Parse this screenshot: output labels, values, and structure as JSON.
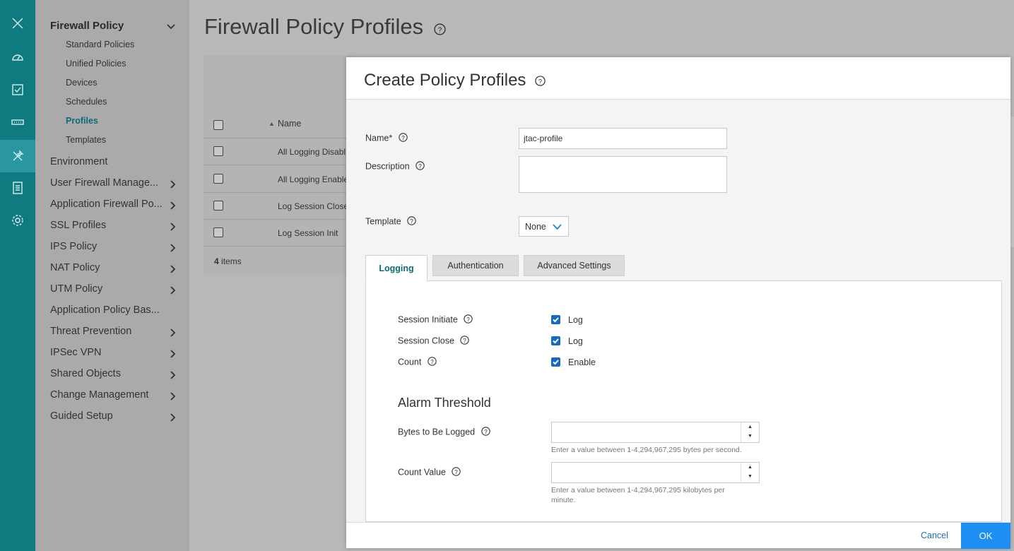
{
  "rail": {
    "icons": [
      "close-icon",
      "dashboard-icon",
      "monitor-icon",
      "devices-icon",
      "configure-icon",
      "reports-icon",
      "settings-icon"
    ]
  },
  "nav": {
    "group_title": "Firewall Policy",
    "subitems": [
      "Standard Policies",
      "Unified Policies",
      "Devices",
      "Schedules",
      "Profiles",
      "Templates"
    ],
    "active_subitem": "Profiles",
    "items": [
      {
        "label": "Environment"
      },
      {
        "label": "User Firewall Manage..."
      },
      {
        "label": "Application Firewall Po..."
      },
      {
        "label": "SSL Profiles"
      },
      {
        "label": "IPS Policy"
      },
      {
        "label": "NAT Policy"
      },
      {
        "label": "UTM Policy"
      },
      {
        "label": "Application Policy Bas..."
      },
      {
        "label": "Threat Prevention"
      },
      {
        "label": "IPSec VPN"
      },
      {
        "label": "Shared Objects"
      },
      {
        "label": "Change Management"
      },
      {
        "label": "Guided Setup"
      }
    ]
  },
  "page": {
    "title": "Firewall Policy Profiles",
    "column_name": "Name",
    "rows": [
      "All Logging Disabl",
      "All Logging Enable",
      "Log Session Close",
      "Log Session Init"
    ],
    "items_count": "4",
    "items_label": "items"
  },
  "modal": {
    "title": "Create Policy Profiles",
    "name_label": "Name*",
    "name_value": "jtac-profile",
    "description_label": "Description",
    "description_value": "",
    "template_label": "Template",
    "template_value": "None",
    "tabs": [
      "Logging",
      "Authentication",
      "Advanced Settings"
    ],
    "active_tab": "Logging",
    "logging": {
      "session_initiate_label": "Session Initiate",
      "session_initiate_option": "Log",
      "session_close_label": "Session Close",
      "session_close_option": "Log",
      "count_label": "Count",
      "count_option": "Enable"
    },
    "alarm": {
      "title": "Alarm Threshold",
      "bytes_label": "Bytes to Be Logged",
      "bytes_value": "",
      "bytes_hint": "Enter a value between 1-4,294,967,295 bytes per second.",
      "count_value_label": "Count Value",
      "count_value": "",
      "count_hint": "Enter a value between 1-4,294,967,295 kilobytes per minute."
    },
    "cancel_label": "Cancel",
    "ok_label": "OK"
  },
  "colors": {
    "rail": "#0f7a80",
    "accent": "#0d6b78",
    "primary_button": "#1e8ff2",
    "checkbox": "#1769c6"
  }
}
